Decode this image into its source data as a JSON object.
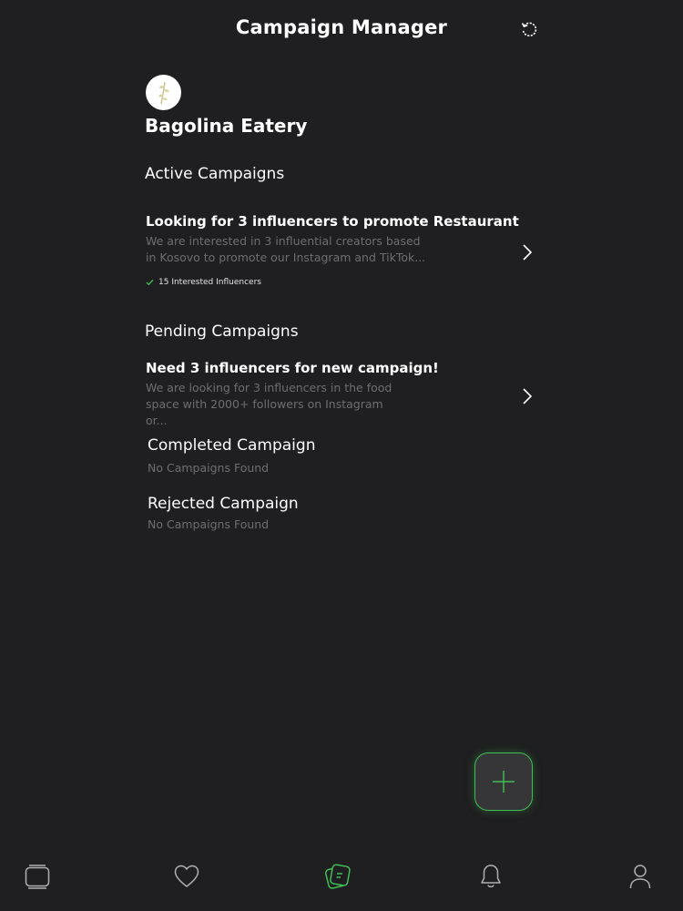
{
  "header": {
    "title": "Campaign Manager",
    "refresh_icon": "refresh-icon"
  },
  "business": {
    "name": "Bagolina Eatery",
    "avatar_icon": "plant-logo"
  },
  "active": {
    "title": "Active Campaigns",
    "campaigns": [
      {
        "title": "Looking for 3 influencers to promote Restaurant",
        "description": "We are interested in 3 influential creators based in Kosovo to promote our Instagram and TikTok...",
        "interested": "15 Interested Influencers"
      }
    ]
  },
  "pending": {
    "title": "Pending Campaigns",
    "campaigns": [
      {
        "title": "Need 3 influencers for new campaign!",
        "description": "We are looking for 3 influencers in the food space with 2000+ followers on Instagram or..."
      }
    ]
  },
  "completed": {
    "title": "Completed Campaign",
    "empty": "No Campaigns Found"
  },
  "rejected": {
    "title": "Rejected Campaign",
    "empty": "No Campaigns Found"
  },
  "fab": {
    "icon": "plus-icon"
  },
  "tabs": [
    {
      "icon": "cards-icon",
      "active": false
    },
    {
      "icon": "heart-icon",
      "active": false
    },
    {
      "icon": "campaigns-icon",
      "active": true
    },
    {
      "icon": "bell-icon",
      "active": false
    },
    {
      "icon": "profile-icon",
      "active": false
    }
  ],
  "colors": {
    "background": "#1f1e20",
    "accent": "#3fbf55",
    "muted_text": "#6e6e72"
  }
}
